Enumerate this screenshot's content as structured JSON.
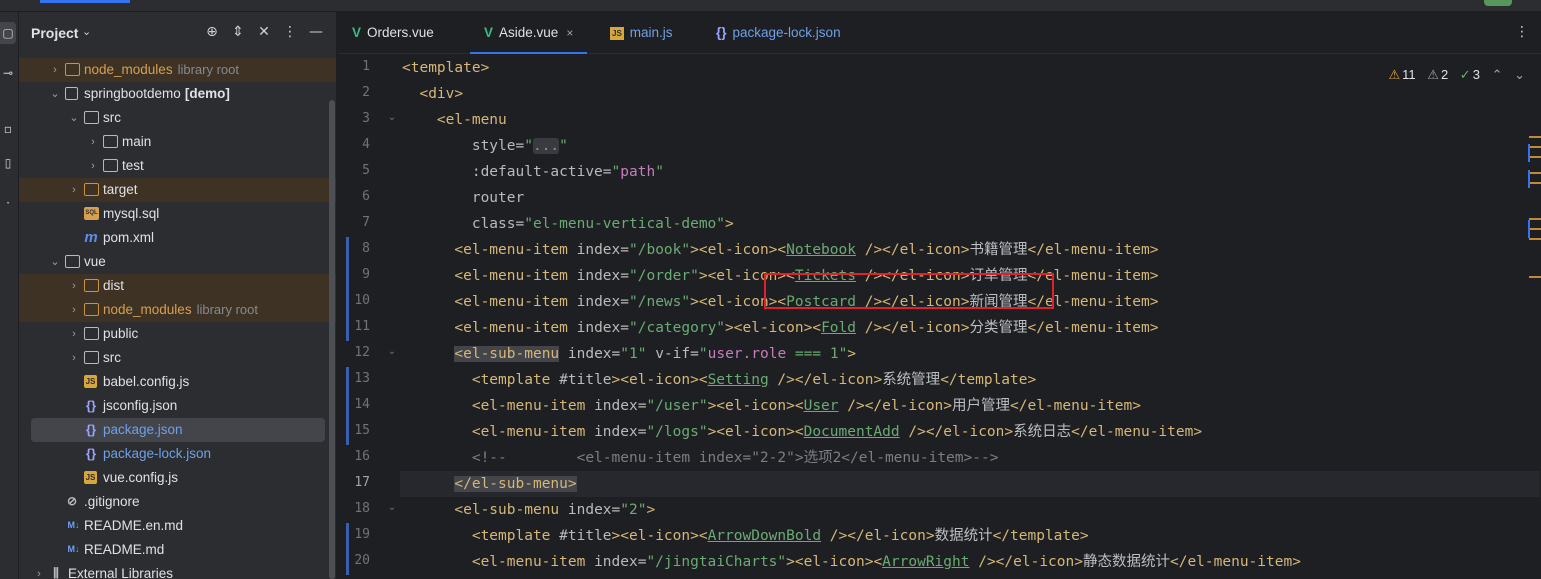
{
  "project": {
    "title": "Project",
    "tree": [
      {
        "label": "node_modules",
        "hint": "library root",
        "type": "folder",
        "color": "orange",
        "excluded": true,
        "depth": 0,
        "arrow": "right"
      },
      {
        "label": "springbootdemo",
        "bold": "[demo]",
        "type": "module",
        "depth": 0,
        "arrow": "down"
      },
      {
        "label": "src",
        "type": "folder",
        "depth": 1,
        "arrow": "down"
      },
      {
        "label": "main",
        "type": "folder",
        "depth": 2,
        "arrow": "right"
      },
      {
        "label": "test",
        "type": "folder",
        "depth": 2,
        "arrow": "right"
      },
      {
        "label": "target",
        "type": "folder",
        "color": "orange-icon",
        "excluded": true,
        "depth": 1,
        "arrow": "right"
      },
      {
        "label": "mysql.sql",
        "type": "sql",
        "depth": 1
      },
      {
        "label": "pom.xml",
        "type": "pom",
        "depth": 1
      },
      {
        "label": "vue",
        "type": "folder",
        "depth": 0,
        "arrow": "down"
      },
      {
        "label": "dist",
        "type": "folder",
        "color": "orange-icon",
        "excluded": true,
        "depth": 1,
        "arrow": "right"
      },
      {
        "label": "node_modules",
        "hint": "library root",
        "type": "folder",
        "color": "orange",
        "excluded": true,
        "depth": 1,
        "arrow": "right"
      },
      {
        "label": "public",
        "type": "folder",
        "depth": 1,
        "arrow": "right"
      },
      {
        "label": "src",
        "type": "folder",
        "depth": 1,
        "arrow": "right"
      },
      {
        "label": "babel.config.js",
        "type": "js",
        "depth": 1
      },
      {
        "label": "jsconfig.json",
        "type": "json",
        "depth": 1
      },
      {
        "label": "package.json",
        "type": "json",
        "color": "blue",
        "selected": true,
        "depth": 1
      },
      {
        "label": "package-lock.json",
        "type": "json",
        "color": "blue",
        "depth": 1
      },
      {
        "label": "vue.config.js",
        "type": "js",
        "depth": 1
      },
      {
        "label": ".gitignore",
        "type": "git",
        "depth": 0
      },
      {
        "label": "README.en.md",
        "type": "md",
        "depth": 0
      },
      {
        "label": "README.md",
        "type": "md",
        "depth": 0
      },
      {
        "label": "External Libraries",
        "type": "lib",
        "depth": -1,
        "arrow": "right"
      }
    ]
  },
  "tabs": [
    {
      "label": "Orders.vue",
      "icon": "V",
      "kind": "vue"
    },
    {
      "label": "Aside.vue",
      "icon": "V",
      "kind": "vue",
      "active": true,
      "close": "×"
    },
    {
      "label": "main.js",
      "icon": "JS",
      "kind": "js"
    },
    {
      "label": "package-lock.json",
      "icon": "{}",
      "kind": "json"
    }
  ],
  "indicators": {
    "warnings": "11",
    "weak": "2",
    "ok": "3"
  },
  "current_line": 17,
  "code_lines": [
    {
      "n": "1",
      "html": "<span class=\"t\">&lt;template&gt;</span>"
    },
    {
      "n": "2",
      "html": "  <span class=\"t\">&lt;div&gt;</span>"
    },
    {
      "n": "3",
      "html": "    <span class=\"t\">&lt;el-menu</span>"
    },
    {
      "n": "4",
      "html": "        <span class=\"a\">style=</span><span class=\"v\">\"<span class=\"fld\">...</span>\"</span>"
    },
    {
      "n": "5",
      "html": "        <span class=\"a\">:default-active=</span><span class=\"v\">\"<span class=\"vv\">path</span>\"</span>"
    },
    {
      "n": "6",
      "html": "        <span class=\"a\">router</span>"
    },
    {
      "n": "7",
      "html": "        <span class=\"a\">class=</span><span class=\"v\">\"el-menu-vertical-demo\"</span><span class=\"t\">&gt;</span>"
    },
    {
      "n": "8",
      "html": "      <span class=\"t\">&lt;el-menu-item </span><span class=\"a\">index=</span><span class=\"v\">\"/book\"</span><span class=\"t\">&gt;&lt;el-icon&gt;&lt;</span><span class=\"v u\">Notebook</span><span class=\"t\"> /&gt;&lt;/el-icon&gt;</span><span class=\"cn\">书籍管理</span><span class=\"t\">&lt;/el-menu-item&gt;</span>"
    },
    {
      "n": "9",
      "html": "      <span class=\"t\">&lt;el-menu-item </span><span class=\"a\">index=</span><span class=\"v\">\"/order\"</span><span class=\"t\">&gt;&lt;el-icon&gt;&lt;</span><span class=\"v u\">Tickets</span><span class=\"t\"> /&gt;&lt;/el-icon&gt;</span><span class=\"cn\">订单管理</span><span class=\"t\">&lt;/el-menu-item&gt;</span>"
    },
    {
      "n": "10",
      "html": "      <span class=\"t\">&lt;el-menu-item </span><span class=\"a\">index=</span><span class=\"v\">\"/news\"</span><span class=\"t\">&gt;&lt;el-icon&gt;&lt;</span><span class=\"v u\">Postcard</span><span class=\"t\"> /&gt;&lt;/el-icon&gt;</span><span class=\"cn\">新闻管理</span><span class=\"t\">&lt;/el-menu-item&gt;</span>"
    },
    {
      "n": "11",
      "html": "      <span class=\"t\">&lt;el-menu-item </span><span class=\"a\">index=</span><span class=\"v\">\"/category\"</span><span class=\"t\">&gt;&lt;el-icon&gt;&lt;</span><span class=\"v u\">Fold</span><span class=\"t\"> /&gt;&lt;/el-icon&gt;</span><span class=\"cn\">分类管理</span><span class=\"t\">&lt;/el-menu-item&gt;</span>"
    },
    {
      "n": "12",
      "html": "      <span class=\"t tagbox\">&lt;el-sub-menu</span> <span class=\"a\">index=</span><span class=\"v\">\"1\"</span> <span class=\"a\">v-if=</span><span class=\"v\">\"<span class=\"vv\">user.role</span> === 1\"</span><span class=\"t\">&gt;</span>"
    },
    {
      "n": "13",
      "html": "        <span class=\"t\">&lt;template </span><span class=\"a\">#title</span><span class=\"t\">&gt;&lt;el-icon&gt;&lt;</span><span class=\"v u\">Setting</span><span class=\"t\"> /&gt;&lt;/el-icon&gt;</span><span class=\"cn\">系统管理</span><span class=\"t\">&lt;/template&gt;</span>"
    },
    {
      "n": "14",
      "html": "        <span class=\"t\">&lt;el-menu-item </span><span class=\"a\">index=</span><span class=\"v\">\"/user\"</span><span class=\"t\">&gt;&lt;el-icon&gt;&lt;</span><span class=\"v u\">User</span><span class=\"t\"> /&gt;&lt;/el-icon&gt;</span><span class=\"cn\">用户管理</span><span class=\"t\">&lt;/el-menu-item&gt;</span>"
    },
    {
      "n": "15",
      "html": "        <span class=\"t\">&lt;el-menu-item </span><span class=\"a\">index=</span><span class=\"v\">\"/logs\"</span><span class=\"t\">&gt;&lt;el-icon&gt;&lt;</span><span class=\"v u\">DocumentAdd</span><span class=\"t\"> /&gt;&lt;/el-icon&gt;</span><span class=\"cn\">系统日志</span><span class=\"t\">&lt;/el-menu-item&gt;</span>"
    },
    {
      "n": "16",
      "html": "        <span class=\"cm\">&lt;!--        &lt;el-menu-item index=\"2-2\"&gt;选项2&lt;/el-menu-item&gt;--&gt;</span>"
    },
    {
      "n": "17",
      "html": "      <span class=\"t tagbox\">&lt;/el-sub-menu&gt;</span>"
    },
    {
      "n": "18",
      "html": "      <span class=\"t\">&lt;el-sub-menu </span><span class=\"a\">index=</span><span class=\"v\">\"2\"</span><span class=\"t\">&gt;</span>"
    },
    {
      "n": "19",
      "html": "        <span class=\"t\">&lt;template </span><span class=\"a\">#title</span><span class=\"t\">&gt;&lt;el-icon&gt;&lt;</span><span class=\"v u\">ArrowDownBold</span><span class=\"t\"> /&gt;&lt;/el-icon&gt;</span><span class=\"cn\">数据统计</span><span class=\"t\">&lt;/template&gt;</span>"
    },
    {
      "n": "20",
      "html": "        <span class=\"t\">&lt;el-menu-item </span><span class=\"a\">index=</span><span class=\"v\">\"/jingtaiCharts\"</span><span class=\"t\">&gt;&lt;el-icon&gt;&lt;</span><span class=\"v u\">ArrowRight</span><span class=\"t\"> /&gt;&lt;/el-icon&gt;</span><span class=\"cn\">静态数据统计</span><span class=\"t\">&lt;/el-menu-item&gt;</span>"
    }
  ]
}
